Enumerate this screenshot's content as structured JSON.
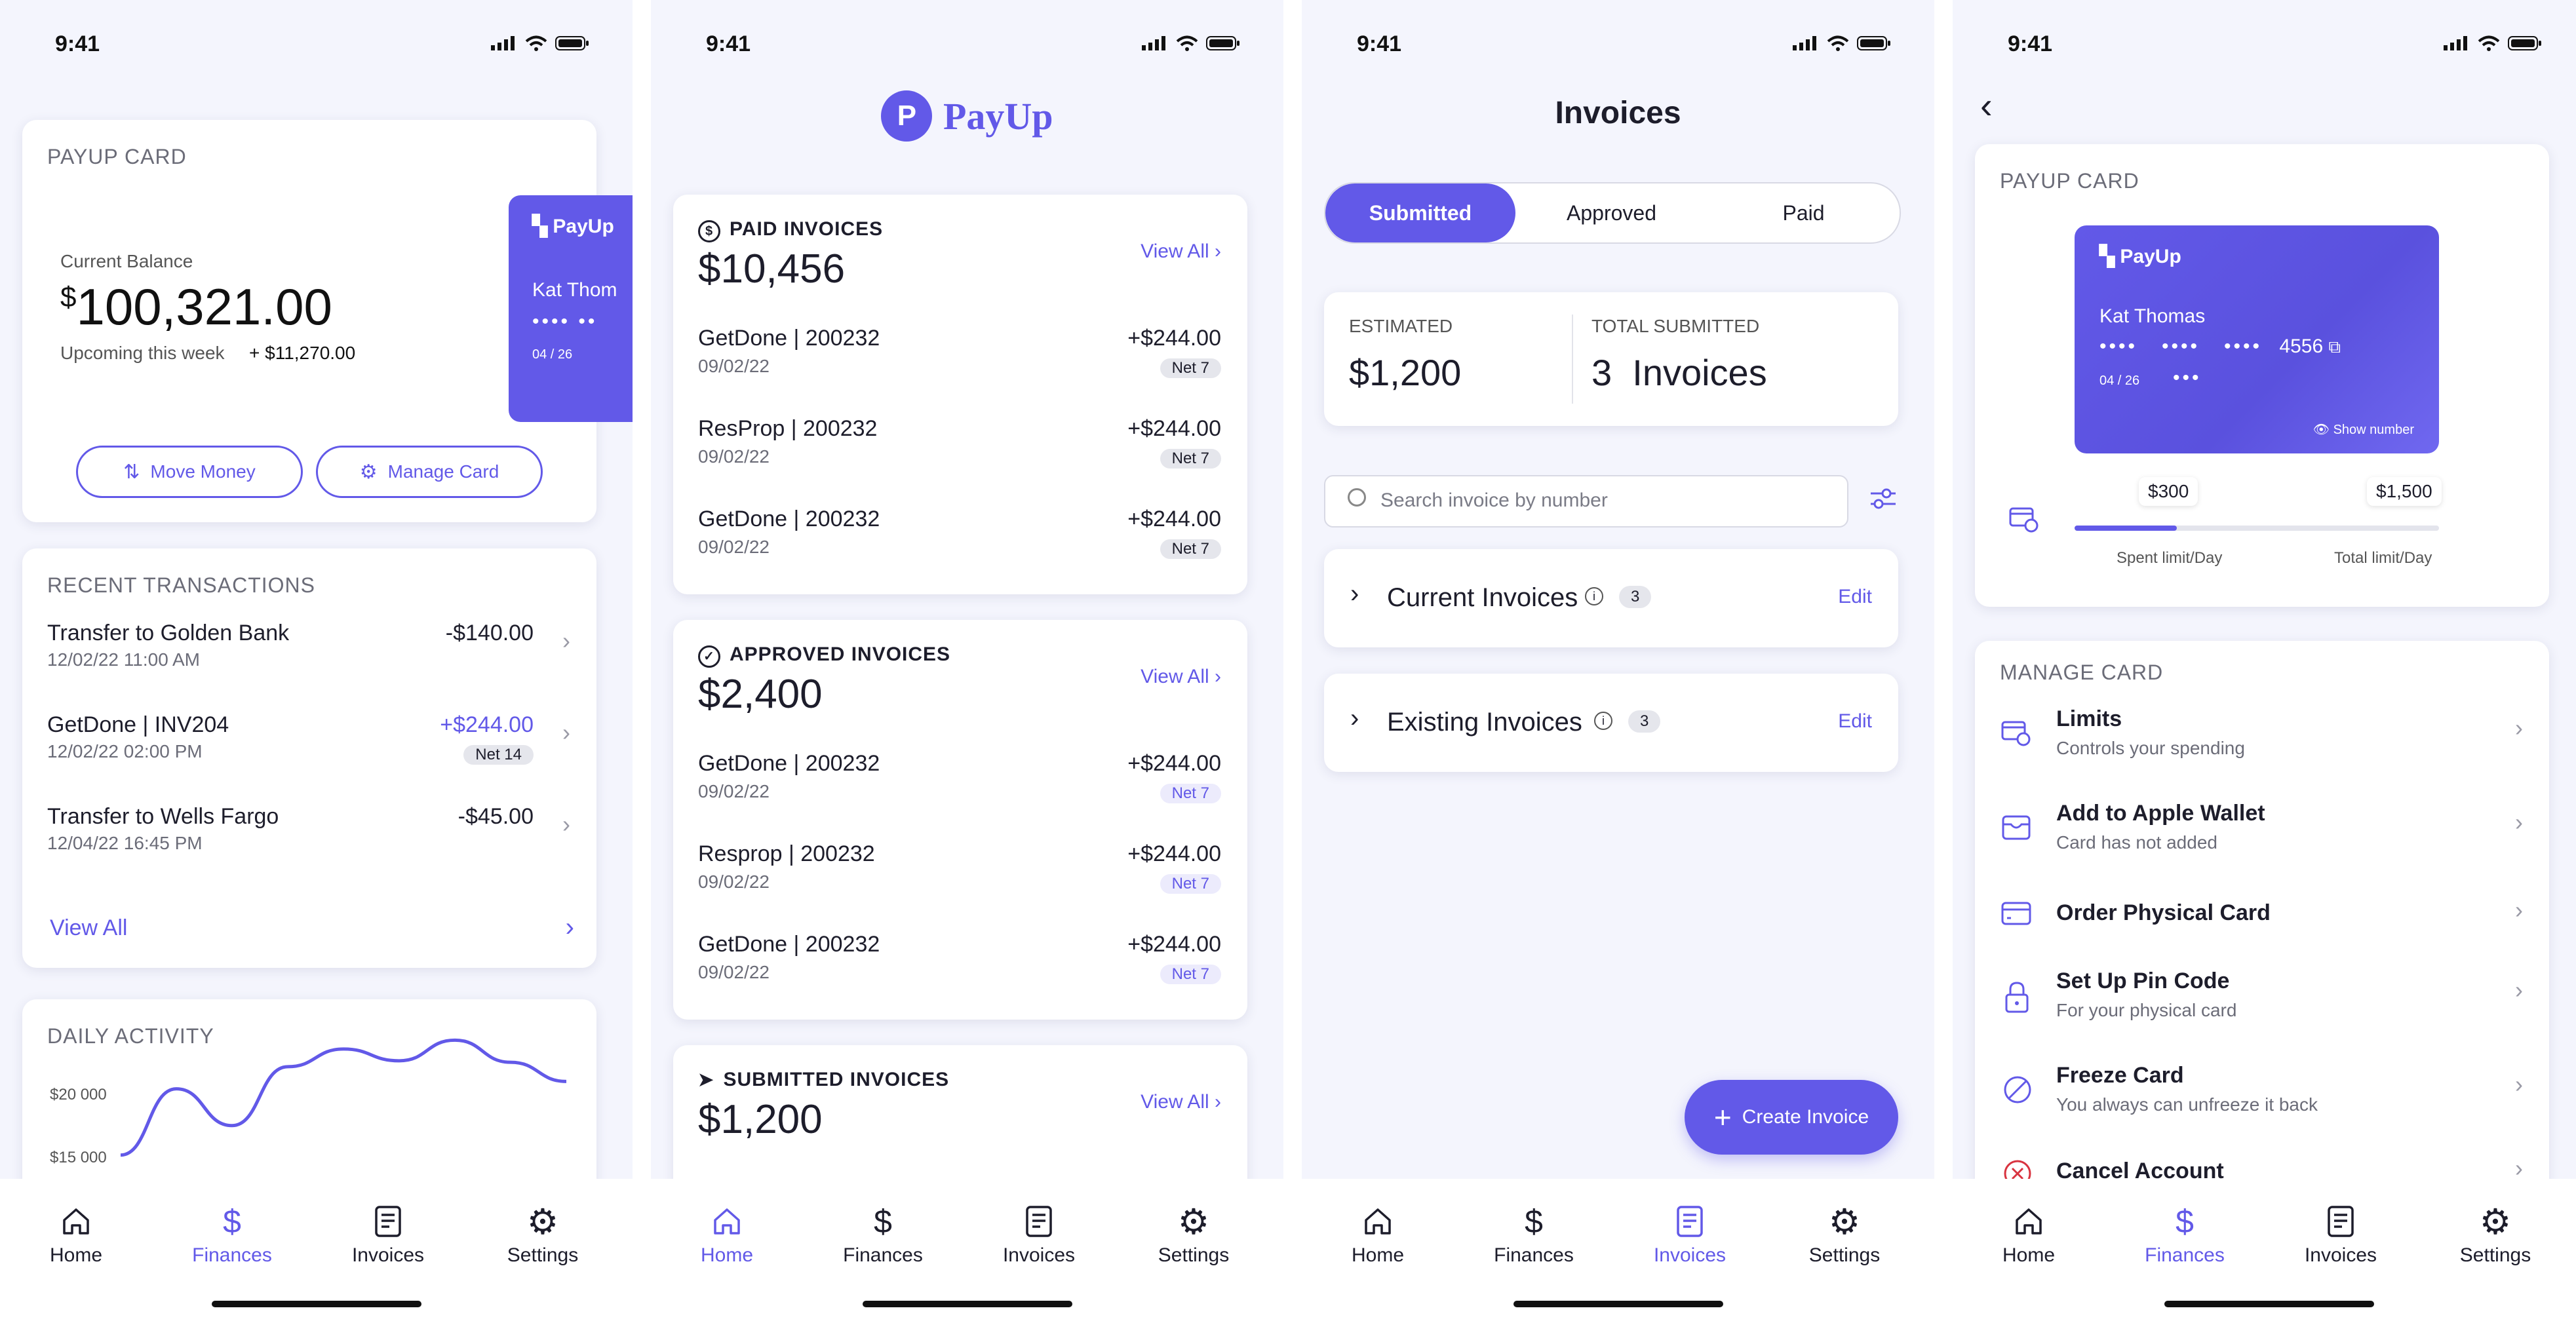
{
  "status": {
    "time": "9:41"
  },
  "tabs": [
    {
      "label": "Home",
      "icon": "home-icon"
    },
    {
      "label": "Finances",
      "icon": "dollar-icon"
    },
    {
      "label": "Invoices",
      "icon": "invoice-icon"
    },
    {
      "label": "Settings",
      "icon": "gear-icon"
    }
  ],
  "colors": {
    "accent": "#6259e8",
    "background": "#f4f5fd",
    "card": "#ffffff",
    "muted": "#6b6c78"
  },
  "screen1": {
    "card_title": "PAYUP CARD",
    "balance_label": "Current Balance",
    "currency": "$",
    "balance": "100,321.00",
    "upcoming_label": "Upcoming this week",
    "upcoming_value": "+ $11,270.00",
    "card_preview": {
      "brand": "PayUp",
      "holder": "Kat Thom",
      "dots": "•••• ••",
      "expiry": "04 / 26"
    },
    "move_money": "Move Money",
    "manage_card": "Manage Card",
    "recent_title": "RECENT TRANSACTIONS",
    "transactions": [
      {
        "title": "Transfer to Golden Bank",
        "date": "12/02/22  11:00 AM",
        "amount": "-$140.00"
      },
      {
        "title": "GetDone | INV204",
        "date": "12/02/22  02:00 PM",
        "amount": "+$244.00",
        "badge": "Net 14"
      },
      {
        "title": "Transfer to Wells Fargo",
        "date": "12/04/22  16:45 PM",
        "amount": "-$45.00"
      }
    ],
    "view_all": "View All",
    "daily_title": "DAILY ACTIVITY",
    "chart_data": {
      "type": "line",
      "title": "DAILY ACTIVITY",
      "y_ticks": [
        "$20 000",
        "$15 000"
      ],
      "ylim": [
        0,
        20000
      ],
      "values": [
        9000,
        13500,
        11000,
        15000,
        16200,
        15400,
        16800,
        15300,
        14000
      ]
    }
  },
  "screen2": {
    "brand": "PayUp",
    "sections": [
      {
        "title": "PAID INVOICES",
        "total": "$10,456",
        "view_all": "View All",
        "pill_style": "grey",
        "items": [
          {
            "name": "GetDone | 200232",
            "date": "09/02/22",
            "amount": "+$244.00",
            "badge": "Net 7"
          },
          {
            "name": "ResProp | 200232",
            "date": "09/02/22",
            "amount": "+$244.00",
            "badge": "Net 7"
          },
          {
            "name": "GetDone | 200232",
            "date": "09/02/22",
            "amount": "+$244.00",
            "badge": "Net 7"
          }
        ]
      },
      {
        "title": "APPROVED INVOICES",
        "total": "$2,400",
        "view_all": "View All",
        "pill_style": "blue",
        "items": [
          {
            "name": "GetDone | 200232",
            "date": "09/02/22",
            "amount": "+$244.00",
            "badge": "Net 7"
          },
          {
            "name": "Resprop | 200232",
            "date": "09/02/22",
            "amount": "+$244.00",
            "badge": "Net 7"
          },
          {
            "name": "GetDone | 200232",
            "date": "09/02/22",
            "amount": "+$244.00",
            "badge": "Net 7"
          }
        ]
      },
      {
        "title": "SUBMITTED INVOICES",
        "total": "$1,200",
        "view_all": "View All",
        "items": []
      }
    ]
  },
  "screen3": {
    "title": "Invoices",
    "segments": [
      "Submitted",
      "Approved",
      "Paid"
    ],
    "estimated_label": "ESTIMATED",
    "estimated_value": "$1,200",
    "submitted_label": "TOTAL SUBMITTED",
    "submitted_value": "3  Invoices",
    "search_placeholder": "Search invoice by number",
    "groups": [
      {
        "title": "Current Invoices",
        "count": "3",
        "action": "Edit"
      },
      {
        "title": "Existing Invoices",
        "count": "3",
        "action": "Edit"
      }
    ],
    "create": "Create Invoice"
  },
  "screen4": {
    "card_title": "PAYUP CARD",
    "card": {
      "brand": "PayUp",
      "holder": "Kat Thomas",
      "dots": "••••   ••••   ••••",
      "last4": "4556",
      "expiry": "04 / 26",
      "cvv": "•••",
      "show": "Show number"
    },
    "spent": "$300",
    "total": "$1,500",
    "spent_label": "Spent limit/Day",
    "total_label": "Total limit/Day",
    "progress": 0.28,
    "manage_title": "MANAGE CARD",
    "items": [
      {
        "title": "Limits",
        "sub": "Controls your spending",
        "icon": "card-clock-icon"
      },
      {
        "title": "Add to Apple Wallet",
        "sub": "Card has not added",
        "icon": "wallet-icon"
      },
      {
        "title": "Order Physical Card",
        "sub": "",
        "icon": "credit-card-icon"
      },
      {
        "title": "Set Up Pin Code",
        "sub": "For your physical card",
        "icon": "lock-icon"
      },
      {
        "title": "Freeze Card",
        "sub": "You always can unfreeze it back",
        "icon": "block-icon"
      },
      {
        "title": "Cancel Account",
        "sub": "",
        "icon": "cancel-icon"
      }
    ]
  }
}
